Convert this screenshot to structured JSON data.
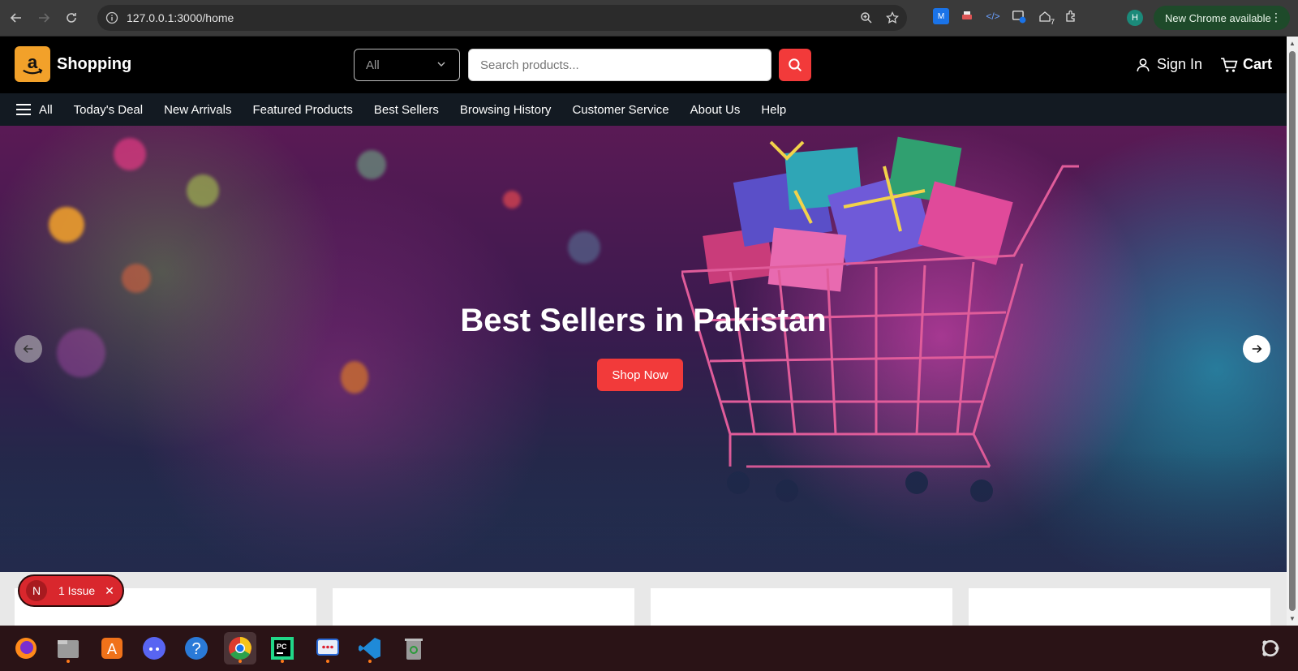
{
  "browser": {
    "url": "127.0.0.1:3000/home",
    "profile_initial": "H",
    "update_label": "New Chrome available",
    "ext_badge": "7"
  },
  "header": {
    "brand": "Shopping",
    "category_selected": "All",
    "search_placeholder": "Search products...",
    "signin_label": "Sign In",
    "cart_label": "Cart"
  },
  "nav": {
    "all_label": "All",
    "items": [
      "Today's Deal",
      "New Arrivals",
      "Featured Products",
      "Best Sellers",
      "Browsing History",
      "Customer Service",
      "About Us",
      "Help"
    ]
  },
  "hero": {
    "title": "Best Sellers in Pakistan",
    "cta": "Shop Now"
  },
  "issue_toast": {
    "initial": "N",
    "label": "1 Issue"
  },
  "colors": {
    "accent": "#f23a3a",
    "brand_orange": "#f2a12a",
    "header_bg": "#000000",
    "nav_bg": "#131a22"
  }
}
